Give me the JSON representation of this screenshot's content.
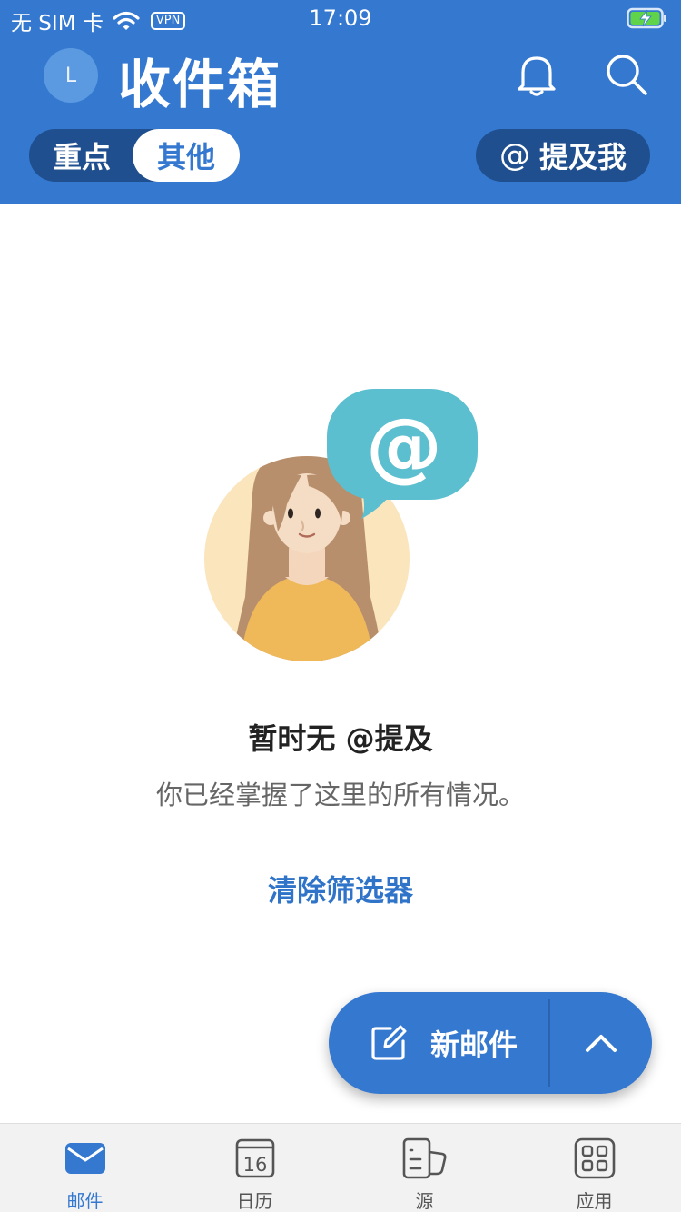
{
  "status_bar": {
    "carrier": "无 SIM 卡",
    "vpn": "VPN",
    "time": "17:09"
  },
  "header": {
    "avatar_initial": "L",
    "title": "收件箱",
    "segments": [
      {
        "label": "重点",
        "selected": false
      },
      {
        "label": "其他",
        "selected": true
      }
    ],
    "mention_label": "提及我",
    "mention_symbol": "@"
  },
  "empty_state": {
    "title": "暂时无 @提及",
    "subtitle": "你已经掌握了这里的所有情况。",
    "clear_filter": "清除筛选器"
  },
  "fab": {
    "new_mail_label": "新邮件"
  },
  "tabbar": {
    "calendar_day": "16",
    "items": [
      {
        "label": "邮件",
        "icon": "mail-icon",
        "active": true
      },
      {
        "label": "日历",
        "icon": "calendar-icon",
        "active": false
      },
      {
        "label": "源",
        "icon": "feed-icon",
        "active": false
      },
      {
        "label": "应用",
        "icon": "apps-icon",
        "active": false
      }
    ]
  },
  "colors": {
    "brand": "#3478d0",
    "segment_bg": "#1f4f8e",
    "illustration_bubble": "#5bbfcf"
  }
}
